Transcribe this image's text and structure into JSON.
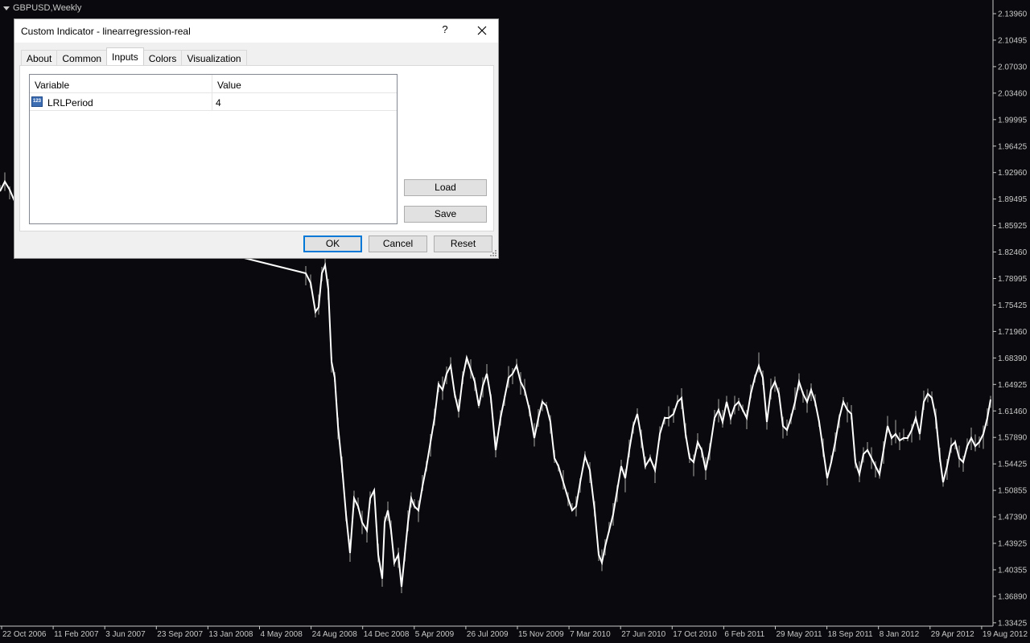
{
  "chart": {
    "symbol": "GBPUSD,Weekly",
    "price_ticks": [
      "2.13960",
      "2.10495",
      "2.07030",
      "2.03460",
      "1.99995",
      "1.96425",
      "1.92960",
      "1.89495",
      "1.85925",
      "1.82460",
      "1.78995",
      "1.75425",
      "1.71960",
      "1.68390",
      "1.64925",
      "1.61460",
      "1.57890",
      "1.54425",
      "1.50855",
      "1.47390",
      "1.43925",
      "1.40355",
      "1.36890",
      "1.33425"
    ],
    "date_ticks": [
      "22 Oct 2006",
      "11 Feb 2007",
      "3 Jun 2007",
      "23 Sep 2007",
      "13 Jan 2008",
      "4 May 2008",
      "24 Aug 2008",
      "14 Dec 2008",
      "5 Apr 2009",
      "26 Jul 2009",
      "15 Nov 2009",
      "7 Mar 2010",
      "27 Jun 2010",
      "17 Oct 2010",
      "6 Feb 2011",
      "29 May 2011",
      "18 Sep 2011",
      "8 Jan 2012",
      "29 Apr 2012",
      "19 Aug 2012"
    ],
    "colors": {
      "background": "#0a090d",
      "line": "#ffffff",
      "bars": "#9a9a9a",
      "axis_text": "#c8c8c8"
    }
  },
  "dialog": {
    "title": "Custom Indicator - linearregression-real",
    "help": "?",
    "tabs": [
      "About",
      "Common",
      "Inputs",
      "Colors",
      "Visualization"
    ],
    "active_tab": "Inputs",
    "table": {
      "headers": [
        "Variable",
        "Value"
      ],
      "rows": [
        {
          "icon": "number-123-icon",
          "icon_text": "123",
          "variable": "LRLPeriod",
          "value": "4"
        }
      ]
    },
    "buttons": {
      "load": "Load",
      "save": "Save",
      "ok": "OK",
      "cancel": "Cancel",
      "reset": "Reset"
    }
  }
}
